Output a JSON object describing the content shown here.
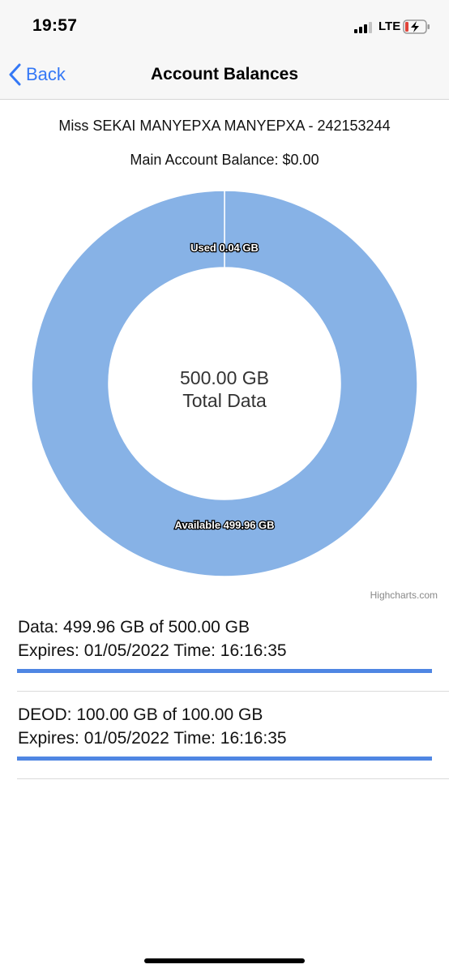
{
  "status_bar": {
    "time": "19:57",
    "network": "LTE",
    "signal_bars_active": 3,
    "signal_bars_total": 4
  },
  "nav": {
    "back_label": "Back",
    "title": "Account Balances"
  },
  "account": {
    "owner": "Miss SEKAI MANYEPXA MANYEPXA - 242153244",
    "main_balance": "Main Account Balance: $0.00"
  },
  "chart_data": {
    "type": "pie",
    "variant": "donut",
    "center_value": "500.00 GB",
    "center_label": "Total Data",
    "slices": [
      {
        "name": "Used",
        "value": 0.04,
        "label": "Used 0.04 GB",
        "color": "#ffffff"
      },
      {
        "name": "Available",
        "value": 499.96,
        "label": "Available 499.96 GB",
        "color": "#87b2e6"
      }
    ],
    "credits": "Highcharts.com"
  },
  "balances": [
    {
      "line1": "Data: 499.96 GB of 500.00 GB",
      "line2": "Expires: 01/05/2022 Time: 16:16:35",
      "remaining_fraction": 0.99992
    },
    {
      "line1": "DEOD: 100.00 GB of 100.00 GB",
      "line2": "Expires: 01/05/2022 Time: 16:16:35",
      "remaining_fraction": 1.0
    }
  ],
  "colors": {
    "accent": "#3478f6",
    "progress_bar": "#4f86e3",
    "donut": "#87b2e6"
  }
}
